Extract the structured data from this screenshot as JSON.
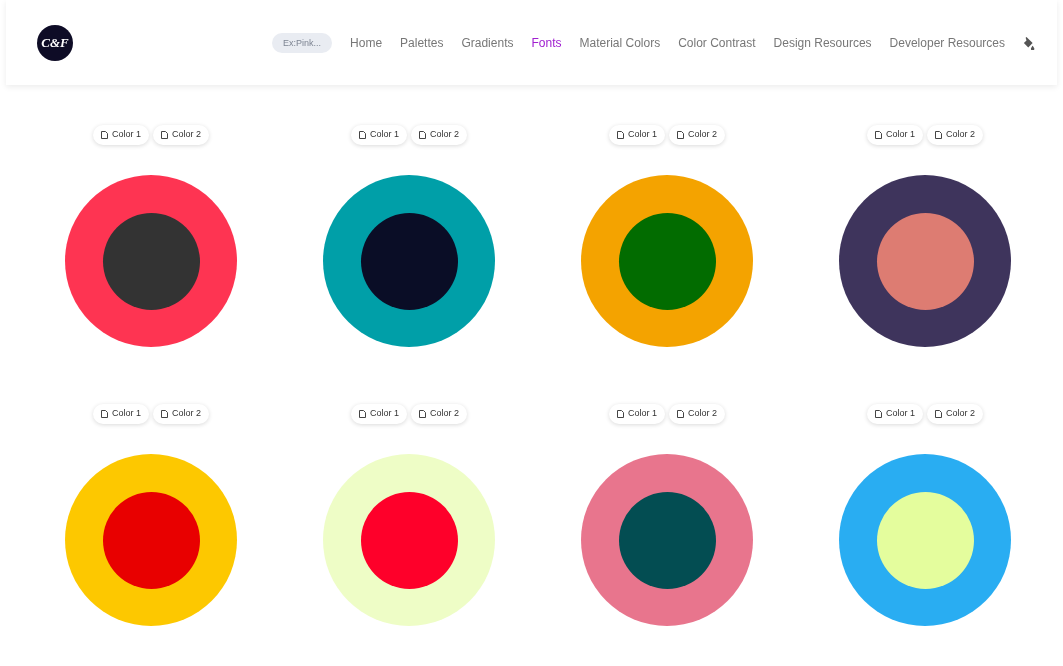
{
  "header": {
    "logo": "C&F",
    "search": {
      "placeholder": "Ex:Pink..."
    },
    "nav": [
      {
        "label": "Home",
        "selected": false
      },
      {
        "label": "Palettes",
        "selected": false
      },
      {
        "label": "Gradients",
        "selected": false
      },
      {
        "label": "Fonts",
        "selected": true
      },
      {
        "label": "Material Colors",
        "selected": false
      },
      {
        "label": "Color Contrast",
        "selected": false
      },
      {
        "label": "Design Resources",
        "selected": false
      },
      {
        "label": "Developer Resources",
        "selected": false
      }
    ]
  },
  "cards": [
    {
      "buttons": [
        "Color 1",
        "Color 2"
      ],
      "outer": {
        "color": "#fe3452"
      },
      "inner": {
        "color": "#333333"
      }
    },
    {
      "buttons": [
        "Color 1",
        "Color 2"
      ],
      "outer": {
        "color": "#009fa8"
      },
      "inner": {
        "color": "#0a0d26"
      }
    },
    {
      "buttons": [
        "Color 1",
        "Color 2"
      ],
      "outer": {
        "color": "#f4a300"
      },
      "inner": {
        "color": "#026c00"
      }
    },
    {
      "buttons": [
        "Color 1",
        "Color 2"
      ],
      "outer": {
        "color": "#3e345c"
      },
      "inner": {
        "color": "#dd7c72"
      }
    },
    {
      "buttons": [
        "Color 1",
        "Color 2"
      ],
      "outer": {
        "color": "#fdc800"
      },
      "inner": {
        "color": "#e80000"
      }
    },
    {
      "buttons": [
        "Color 1",
        "Color 2"
      ],
      "outer": {
        "color": "#eefdc6"
      },
      "inner": {
        "color": "#fe002a"
      }
    },
    {
      "buttons": [
        "Color 1",
        "Color 2"
      ],
      "outer": {
        "color": "#e8758d"
      },
      "inner": {
        "color": "#034d52"
      }
    },
    {
      "buttons": [
        "Color 1",
        "Color 2"
      ],
      "outer": {
        "color": "#29adf2"
      },
      "inner": {
        "color": "#e4fd9d"
      }
    }
  ]
}
